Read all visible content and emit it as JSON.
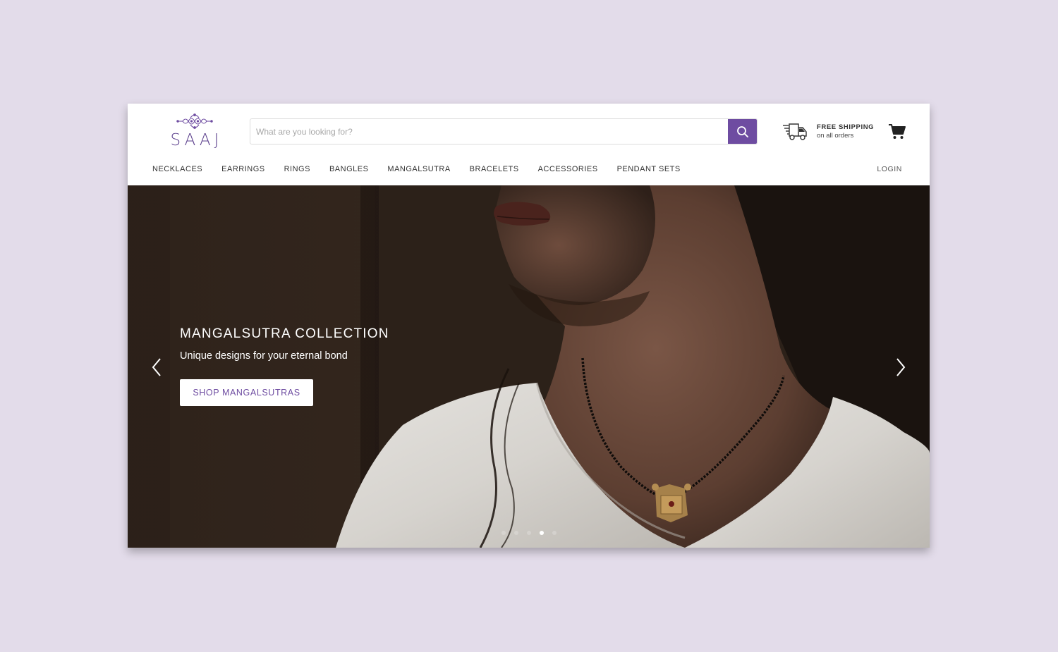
{
  "brand": {
    "name": "SAAJ",
    "accent_color": "#6e4ca1"
  },
  "search": {
    "placeholder": "What are you looking for?",
    "value": "",
    "button_icon": "search-icon"
  },
  "shipping": {
    "icon": "delivery-truck-icon",
    "title": "FREE SHIPPING",
    "subtitle": "on all orders"
  },
  "cart": {
    "icon": "shopping-cart-icon"
  },
  "nav": {
    "items": [
      {
        "label": "NECKLACES"
      },
      {
        "label": "EARRINGS"
      },
      {
        "label": "RINGS"
      },
      {
        "label": "BANGLES"
      },
      {
        "label": "MANGALSUTRA"
      },
      {
        "label": "BRACELETS"
      },
      {
        "label": "ACCESSORIES"
      },
      {
        "label": "PENDANT SETS"
      }
    ],
    "login_label": "LOGIN"
  },
  "hero": {
    "title": "MANGALSUTRA COLLECTION",
    "subtitle": "Unique designs for your eternal bond",
    "cta_label": "SHOP MANGALSUTRAS",
    "prev_icon": "chevron-left-icon",
    "next_icon": "chevron-right-icon",
    "slide_count": 5,
    "active_slide": 4
  }
}
